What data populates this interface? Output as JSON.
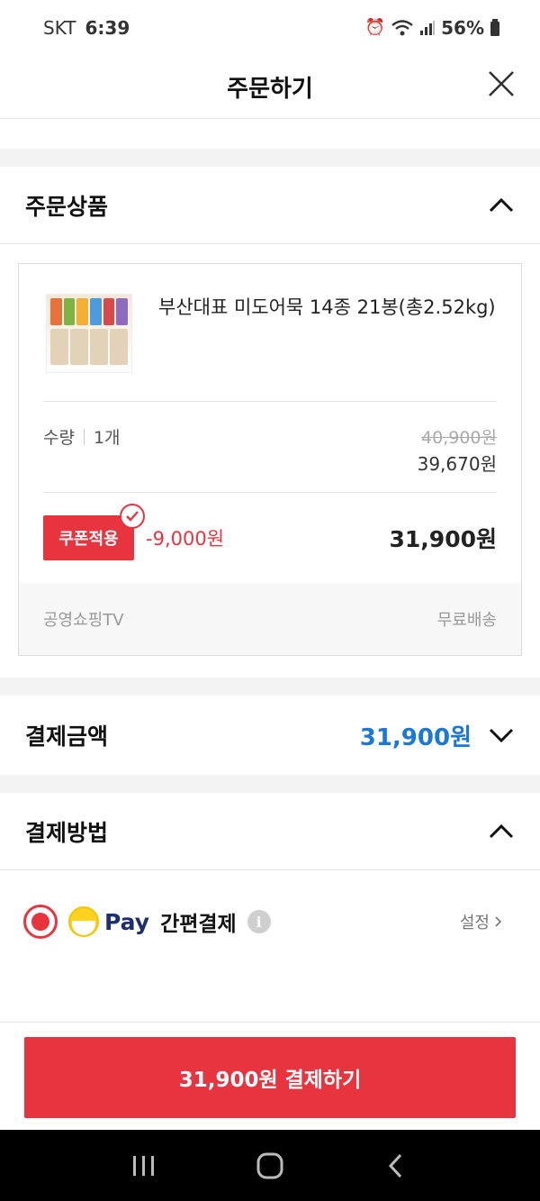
{
  "status_bar": {
    "carrier": "SKT",
    "time": "6:39",
    "battery": "56%",
    "icons": [
      "alarm-icon",
      "wifi-icon",
      "signal-icon",
      "battery-icon"
    ]
  },
  "header": {
    "title": "주문하기",
    "close_icon": "close-icon"
  },
  "order_items": {
    "section_label": "주문상품",
    "product": {
      "name": "부산대표 미도어묵 14종 21봉(총2.52kg)",
      "quantity_label": "수량",
      "quantity": "1개",
      "original_price": "40,900원",
      "sale_price": "39,670원",
      "coupon_label": "쿠폰적용",
      "discount": "-9,000원",
      "final_price": "31,900원",
      "seller": "공영쇼핑TV",
      "shipping": "무료배송"
    }
  },
  "payment_amount": {
    "label": "결제금액",
    "amount": "31,900원"
  },
  "payment_method": {
    "label": "결제방법",
    "pay_brand": "Pay",
    "pay_name": "간편결제",
    "settings_label": "설정",
    "info_glyph": "i"
  },
  "bottom": {
    "pay_button_label": "31,900원 결제하기"
  },
  "colors": {
    "accent_red": "#e8343f",
    "price_blue": "#1a78d8",
    "pay_yellow": "#ffd21f",
    "pay_navy": "#1d2f6e"
  }
}
